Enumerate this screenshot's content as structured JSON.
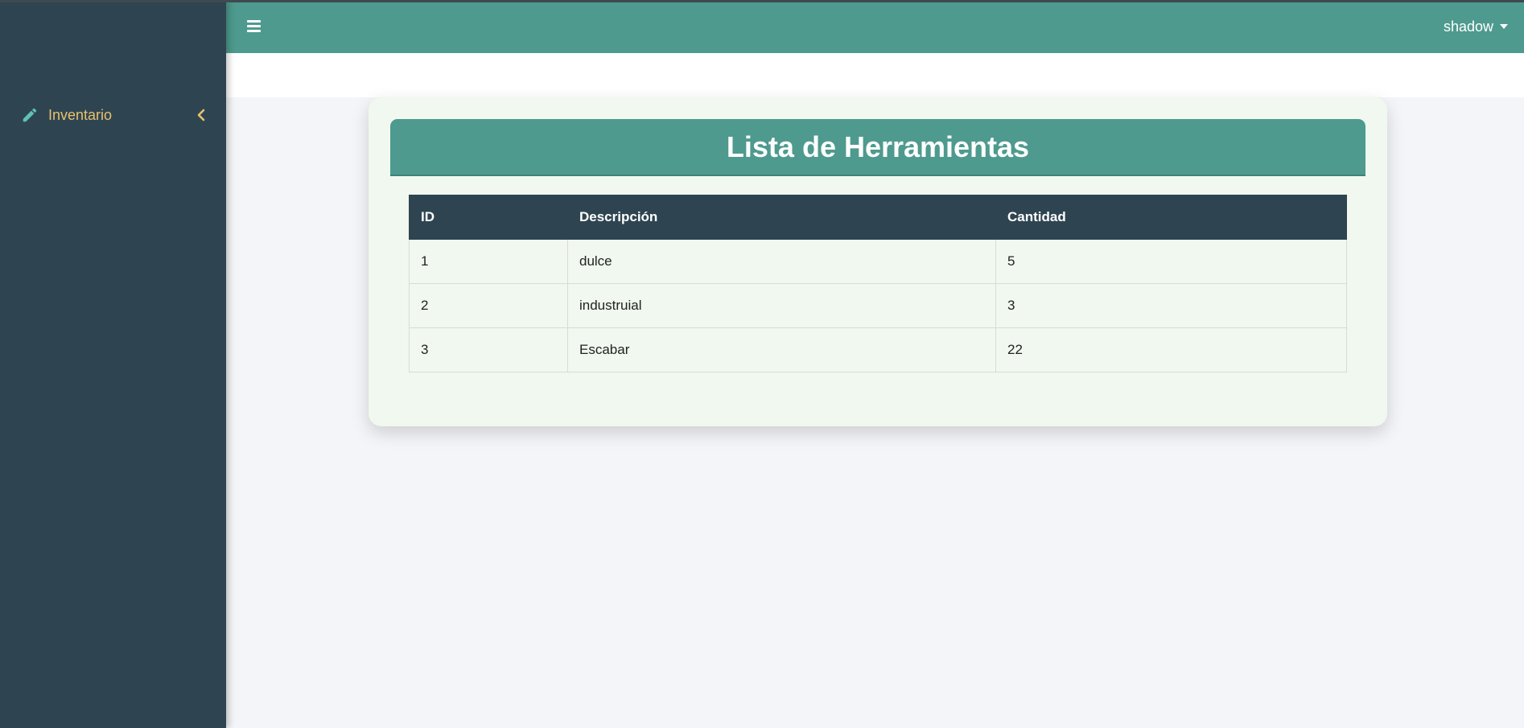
{
  "sidebar": {
    "items": [
      {
        "label": "Inventario",
        "icon": "pencil-icon",
        "expand_icon": "chevron-left-icon"
      }
    ]
  },
  "topbar": {
    "menu_icon": "hamburger-icon",
    "user": "shadow"
  },
  "card": {
    "title": "Lista de Herramientas",
    "table": {
      "headers": [
        "ID",
        "Descripción",
        "Cantidad"
      ],
      "rows": [
        [
          "1",
          "dulce",
          "5"
        ],
        [
          "2",
          "industruial",
          "3"
        ],
        [
          "3",
          "Escabar",
          "22"
        ]
      ]
    }
  },
  "colors": {
    "accent_teal": "#4e9a8e",
    "sidebar_dark": "#2e4551",
    "sidebar_text": "#e9c16e",
    "card_bg": "#f1f8ef"
  }
}
